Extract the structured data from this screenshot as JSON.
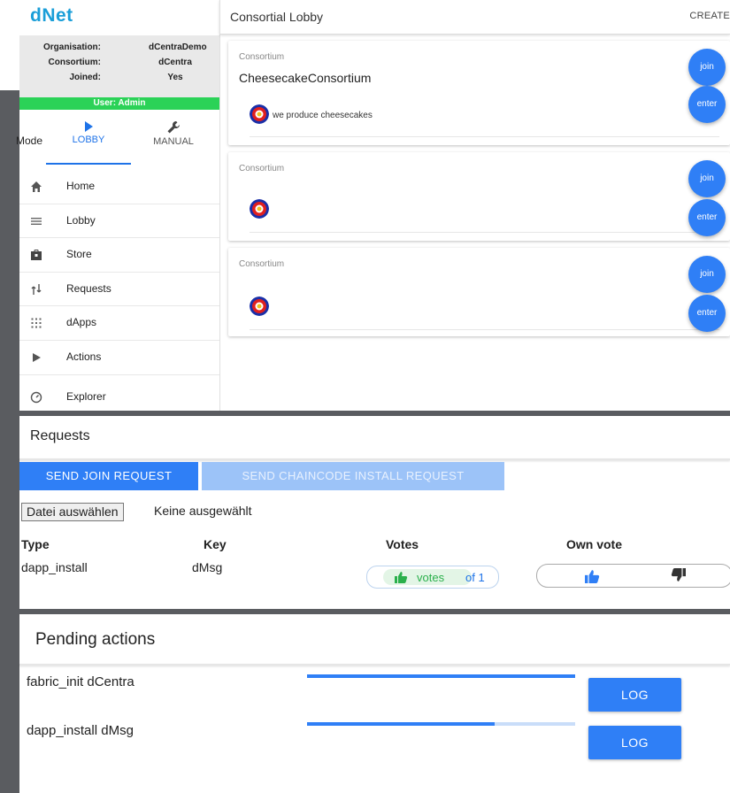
{
  "app": {
    "logo": "dNet"
  },
  "sidebar": {
    "org": [
      {
        "key": "Organisation:",
        "value": "dCentraDemo"
      },
      {
        "key": "Consortium:",
        "value": "dCentra"
      },
      {
        "key": "Joined:",
        "value": "Yes"
      }
    ],
    "user": "User: Admin",
    "mode_label": "Mode",
    "nav": {
      "lobby": "LOBBY",
      "manual": "MANUAL"
    },
    "menu": [
      {
        "label": "Home",
        "icon": "home-icon"
      },
      {
        "label": "Lobby",
        "icon": "menu-icon"
      },
      {
        "label": "Store",
        "icon": "store-icon"
      },
      {
        "label": "Requests",
        "icon": "requests-icon"
      },
      {
        "label": "dApps",
        "icon": "apps-icon"
      },
      {
        "label": "Actions",
        "icon": "play-icon"
      },
      {
        "label": "Explorer",
        "icon": "explorer-icon"
      }
    ]
  },
  "header": {
    "title": "Consortial Lobby",
    "create": "CREATE"
  },
  "consortia": [
    {
      "label": "Consortium",
      "name": "CheesecakeConsortium",
      "description": "we produce cheesecakes",
      "join": "join",
      "enter": "enter"
    },
    {
      "label": "Consortium",
      "name": "",
      "description": "",
      "join": "join",
      "enter": "enter"
    },
    {
      "label": "Consortium",
      "name": "",
      "description": "",
      "join": "join",
      "enter": "enter"
    }
  ],
  "requests": {
    "title": "Requests",
    "send_join": "SEND JOIN REQUEST",
    "send_chaincode": "SEND CHAINCODE INSTALL REQUEST",
    "file_button": "Datei auswählen",
    "file_status": "Keine ausgewählt",
    "columns": {
      "type": "Type",
      "key": "Key",
      "votes": "Votes",
      "own_vote": "Own vote"
    },
    "rows": [
      {
        "type": "dapp_install",
        "key": "dMsg",
        "votes_label": "votes",
        "votes_of": "of 1"
      }
    ]
  },
  "pending": {
    "title": "Pending actions",
    "items": [
      {
        "label": "fabric_init dCentra",
        "progress": 1.0,
        "log": "LOG"
      },
      {
        "label": "dapp_install dMsg",
        "progress": 0.7,
        "log": "LOG"
      }
    ]
  },
  "colors": {
    "primary": "#2f7ff6",
    "user_bar": "#2bd257",
    "logo": "#1a9ed8"
  }
}
